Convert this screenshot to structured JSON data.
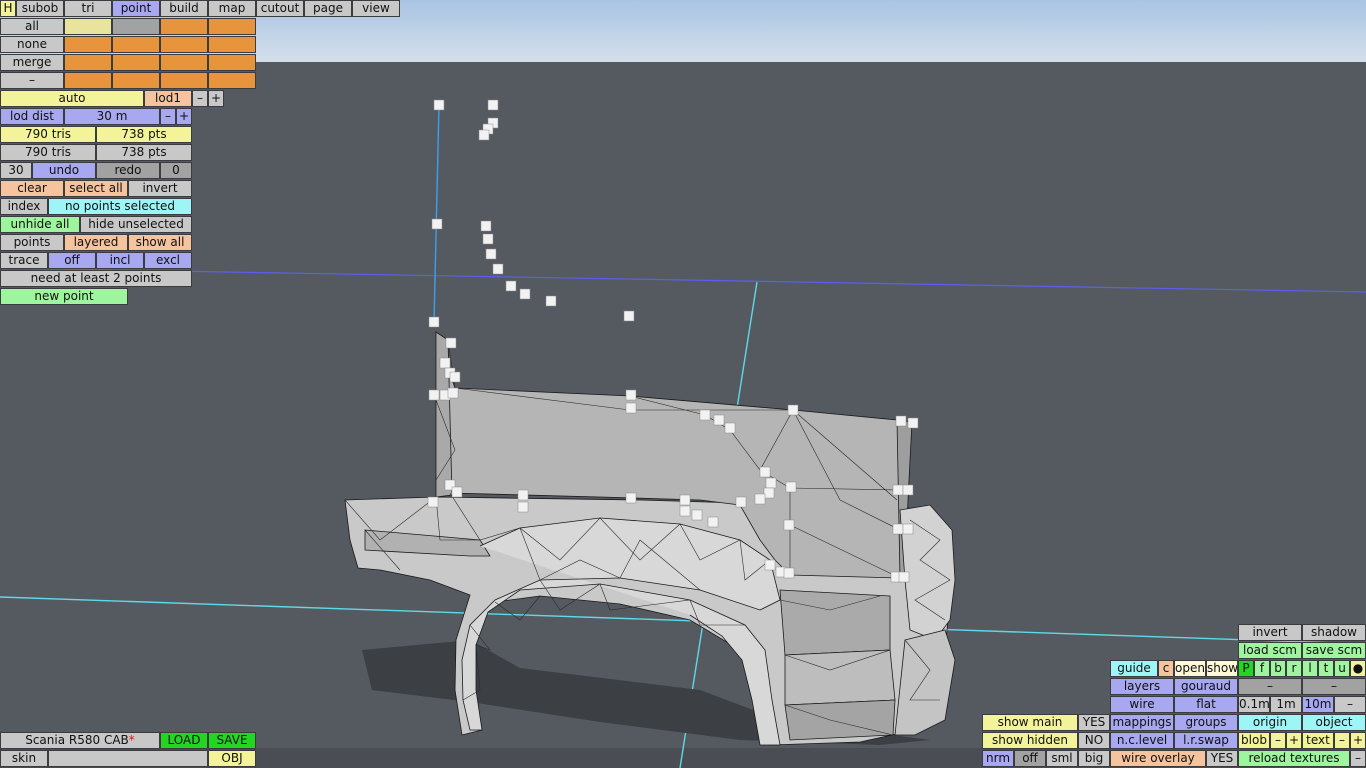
{
  "accent_colors": {
    "yellow": "#f3f39a",
    "orange": "#e8943c",
    "purple": "#a8a8f0",
    "cyan": "#9ef5f5",
    "green": "#9ef59e",
    "bright_green": "#22d622",
    "peach": "#f5c49e",
    "grey": "#c8c8c8"
  },
  "top_menu": {
    "h": "H",
    "tabs": [
      "subob",
      "tri",
      "point",
      "build",
      "map",
      "cutout",
      "page",
      "view"
    ],
    "active": "point"
  },
  "selection": {
    "all": "all",
    "none": "none",
    "merge": "merge",
    "minus": "–"
  },
  "lod": {
    "auto": "auto",
    "lod": "lod1",
    "minus": "–",
    "plus": "+",
    "dist_label": "lod dist",
    "dist_value": "30 m"
  },
  "stats": {
    "tris1": "790 tris",
    "pts1": "738 pts",
    "tris2": "790 tris",
    "pts2": "738 pts"
  },
  "history": {
    "count": "30",
    "undo": "undo",
    "redo": "redo",
    "redo_count": "0"
  },
  "actions": {
    "clear": "clear",
    "select_all": "select all",
    "invert": "invert"
  },
  "index": {
    "label": "index",
    "status": "no points selected"
  },
  "hide": {
    "unhide_all": "unhide all",
    "hide_unselected": "hide unselected"
  },
  "points_row": {
    "points": "points",
    "layered": "layered",
    "show_all": "show all"
  },
  "trace": {
    "label": "trace",
    "off": "off",
    "incl": "incl",
    "excl": "excl"
  },
  "messages": {
    "need_points": "need at least 2 points",
    "new_point": "new point"
  },
  "model_bar": {
    "name": "Scania R580 CAB",
    "modified_marker": "*",
    "load": "LOAD",
    "save": "SAVE",
    "skin": "skin",
    "obj": "OBJ"
  },
  "bottom_left_panel": {
    "show_main": "show main",
    "show_main_val": "YES",
    "show_hidden": "show hidden",
    "show_hidden_val": "NO",
    "nrm": "nrm",
    "off": "off",
    "sml": "sml",
    "big": "big"
  },
  "right_panel": {
    "invert": "invert",
    "shadow": "shadow",
    "load_scm": "load scm",
    "save_scm": "save scm",
    "guide": "guide",
    "c": "c",
    "open": "open",
    "show": "show",
    "views": [
      "P",
      "f",
      "b",
      "r",
      "l",
      "t",
      "u"
    ],
    "dot": "●",
    "layers": "layers",
    "gouraud": "gouraud",
    "dash1": "–",
    "dash2": "–",
    "wire": "wire",
    "flat": "flat",
    "s1": "0.1m",
    "s2": "1m",
    "s3": "10m",
    "s_minus": "–",
    "mappings": "mappings",
    "groups": "groups",
    "origin": "origin",
    "object": "object",
    "nclevel": "n.c.level",
    "lrswap": "l.r.swap",
    "blob": "blob",
    "blob_minus": "–",
    "blob_plus": "+",
    "text": "text",
    "text_minus": "–",
    "text_plus": "+",
    "wire_overlay": "wire overlay",
    "wire_overlay_val": "YES",
    "reload_textures": "reload textures",
    "reload_minus": "–"
  }
}
